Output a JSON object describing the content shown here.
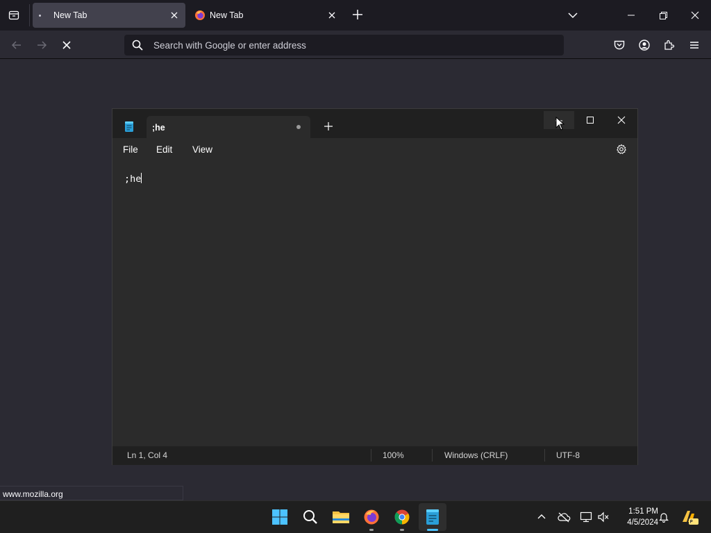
{
  "browser": {
    "tabs": [
      {
        "title": "New Tab"
      },
      {
        "title": "New Tab"
      }
    ],
    "urlbar": {
      "placeholder": "Search with Google or enter address"
    },
    "status_url": "www.mozilla.org"
  },
  "notepad": {
    "tab_title": ";he",
    "menu": [
      "File",
      "Edit",
      "View"
    ],
    "content": ";he",
    "status": {
      "position": "Ln 1, Col 4",
      "zoom": "100%",
      "line_ending": "Windows (CRLF)",
      "encoding": "UTF-8"
    }
  },
  "taskbar": {
    "apps": [
      "start-icon",
      "search-icon",
      "file-explorer-icon",
      "firefox-icon",
      "chrome-icon",
      "notepad-icon"
    ],
    "clock": {
      "time": "1:51 PM",
      "date": "4/5/2024"
    }
  },
  "colors": {
    "accent": "#4cc2ff",
    "browser_bg": "#2b2a33",
    "tabstrip_bg": "#1c1b22"
  }
}
